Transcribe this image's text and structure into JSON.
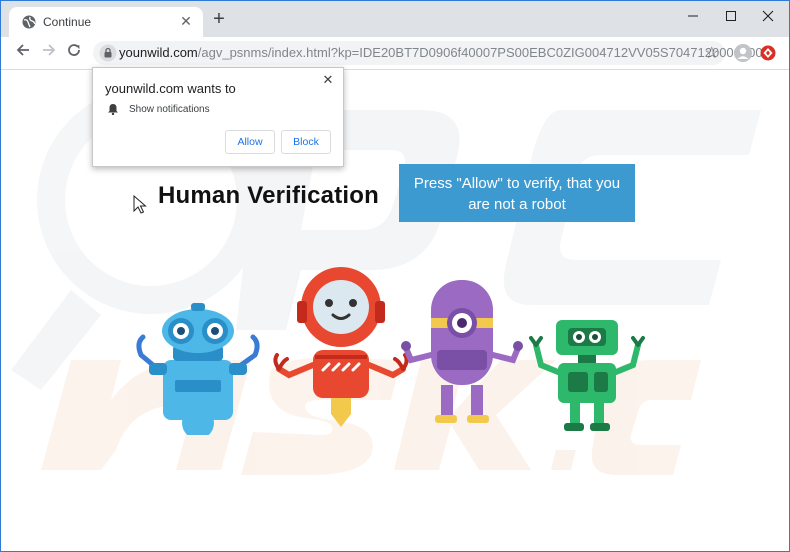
{
  "tab": {
    "title": "Continue",
    "favicon": "globe-icon",
    "close_icon": "close-icon"
  },
  "window_controls": {
    "minimize": "minimize-icon",
    "maximize": "maximize-icon",
    "close": "close-icon"
  },
  "newtab_icon": "plus-icon",
  "toolbar": {
    "url_domain": "younwild.com",
    "url_path": "/agv_psnms/index.html?kp=IDE20BT7D0906f40007PS00EBC0ZIG004712VV05S70471200000000",
    "back_icon": "arrow-left-icon",
    "forward_icon": "arrow-right-icon",
    "reload_icon": "reload-icon",
    "lock_icon": "lock-icon",
    "star_icon": "star-icon",
    "profile_icon": "profile-icon",
    "extension_icon": "extension-icon"
  },
  "notification": {
    "title": "younwild.com wants to",
    "description": "Show notifications",
    "allow_label": "Allow",
    "block_label": "Block",
    "bell_icon": "bell-icon"
  },
  "page": {
    "headline": "Human Verification",
    "cta_text": "Press \"Allow\" to verify, that you are not a robot"
  },
  "colors": {
    "cta_background": "#3d9ad1",
    "window_border": "#2f7bd6",
    "link_blue": "#1a73e8"
  }
}
